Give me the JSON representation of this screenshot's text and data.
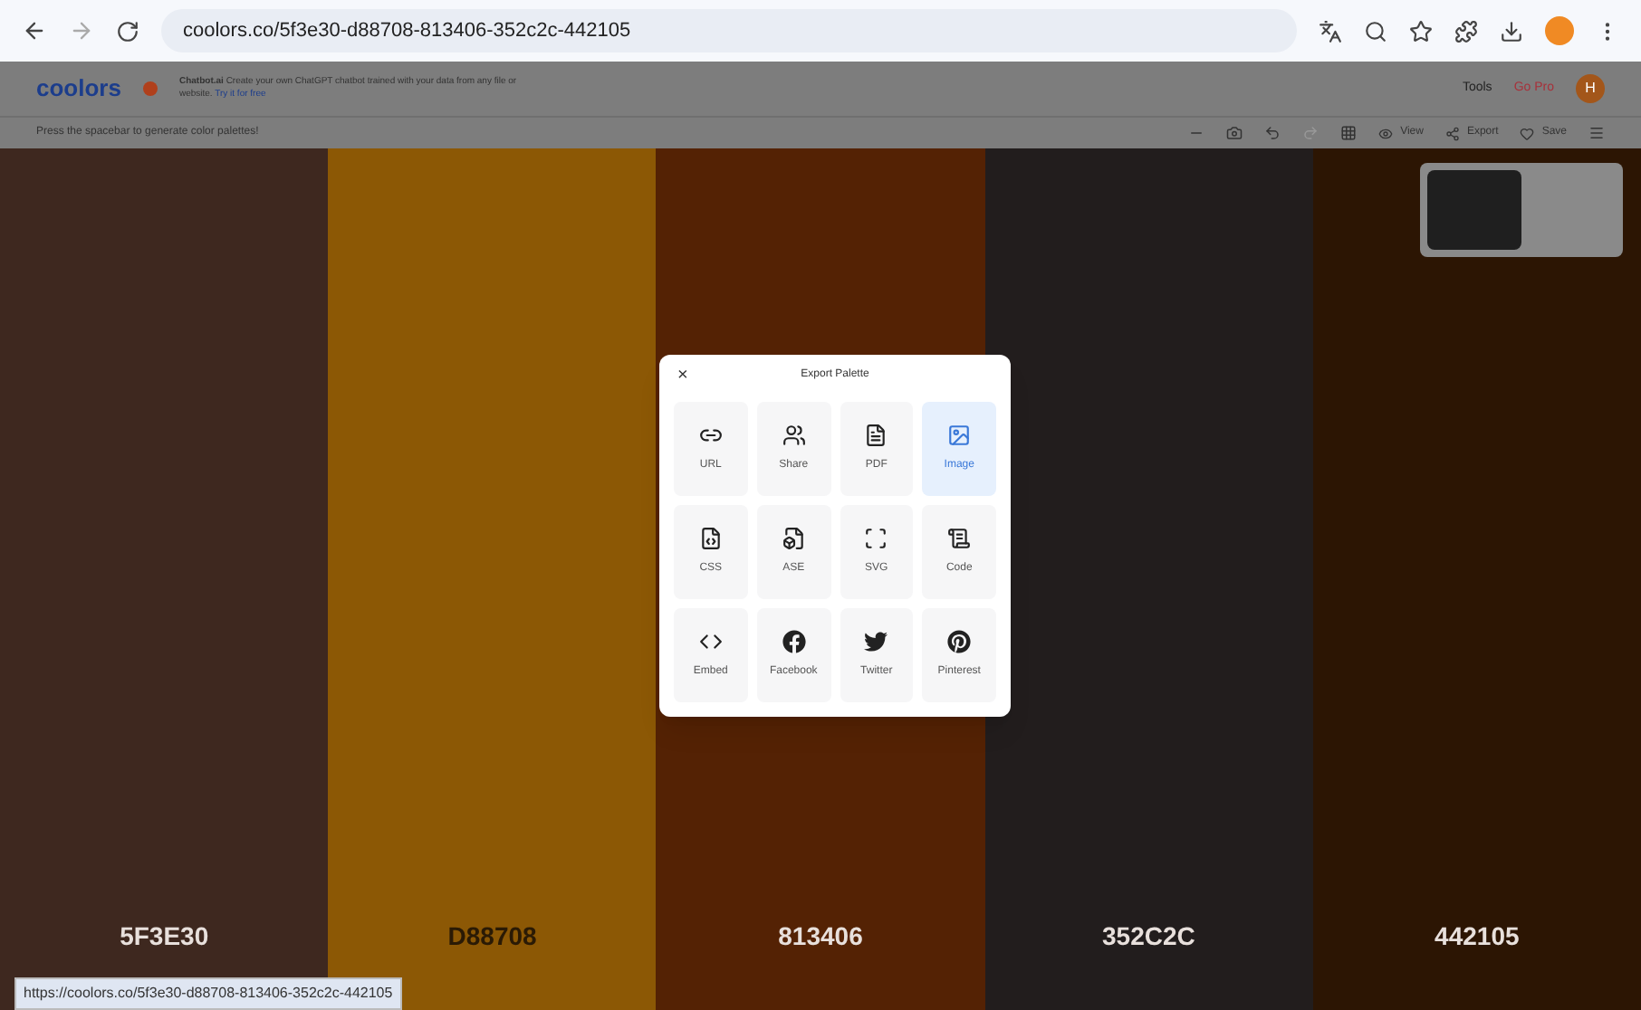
{
  "browser": {
    "url": "coolors.co/5f3e30-d88708-813406-352c2c-442105",
    "status_url": "https://coolors.co/5f3e30-d88708-813406-352c2c-442105"
  },
  "header": {
    "logo": "coolors",
    "ad_title": "Chatbot.ai",
    "ad_text": "Create your own ChatGPT chatbot trained with your data from any file or website.",
    "ad_link": "Try it for free",
    "tools": "Tools",
    "go_pro": "Go Pro",
    "avatar": "H"
  },
  "toolbar": {
    "hint": "Press the spacebar to generate color palettes!",
    "actions": [
      "View",
      "Export",
      "Save"
    ]
  },
  "palette": [
    {
      "hex": "5F3E30",
      "color": "#3e281f",
      "light_text": true
    },
    {
      "hex": "D88708",
      "color": "#8c5805",
      "light_text": false
    },
    {
      "hex": "813406",
      "color": "#542204",
      "light_text": true
    },
    {
      "hex": "352C2C",
      "color": "#221d1d",
      "light_text": true
    },
    {
      "hex": "442105",
      "color": "#2c1503",
      "light_text": true
    }
  ],
  "dialog": {
    "title": "Export Palette",
    "close": "×",
    "options": [
      {
        "kind": "url",
        "label": "URL",
        "selected": false
      },
      {
        "kind": "share",
        "label": "Share",
        "selected": false
      },
      {
        "kind": "pdf",
        "label": "PDF",
        "selected": false
      },
      {
        "kind": "image",
        "label": "Image",
        "selected": true
      },
      {
        "kind": "css",
        "label": "CSS",
        "selected": false
      },
      {
        "kind": "ase",
        "label": "ASE",
        "selected": false
      },
      {
        "kind": "svg",
        "label": "SVG",
        "selected": false
      },
      {
        "kind": "code",
        "label": "Code",
        "selected": false
      },
      {
        "kind": "embed",
        "label": "Embed",
        "selected": false
      },
      {
        "kind": "facebook",
        "label": "Facebook",
        "selected": false
      },
      {
        "kind": "twitter",
        "label": "Twitter",
        "selected": false
      },
      {
        "kind": "pinterest",
        "label": "Pinterest",
        "selected": false
      }
    ]
  }
}
